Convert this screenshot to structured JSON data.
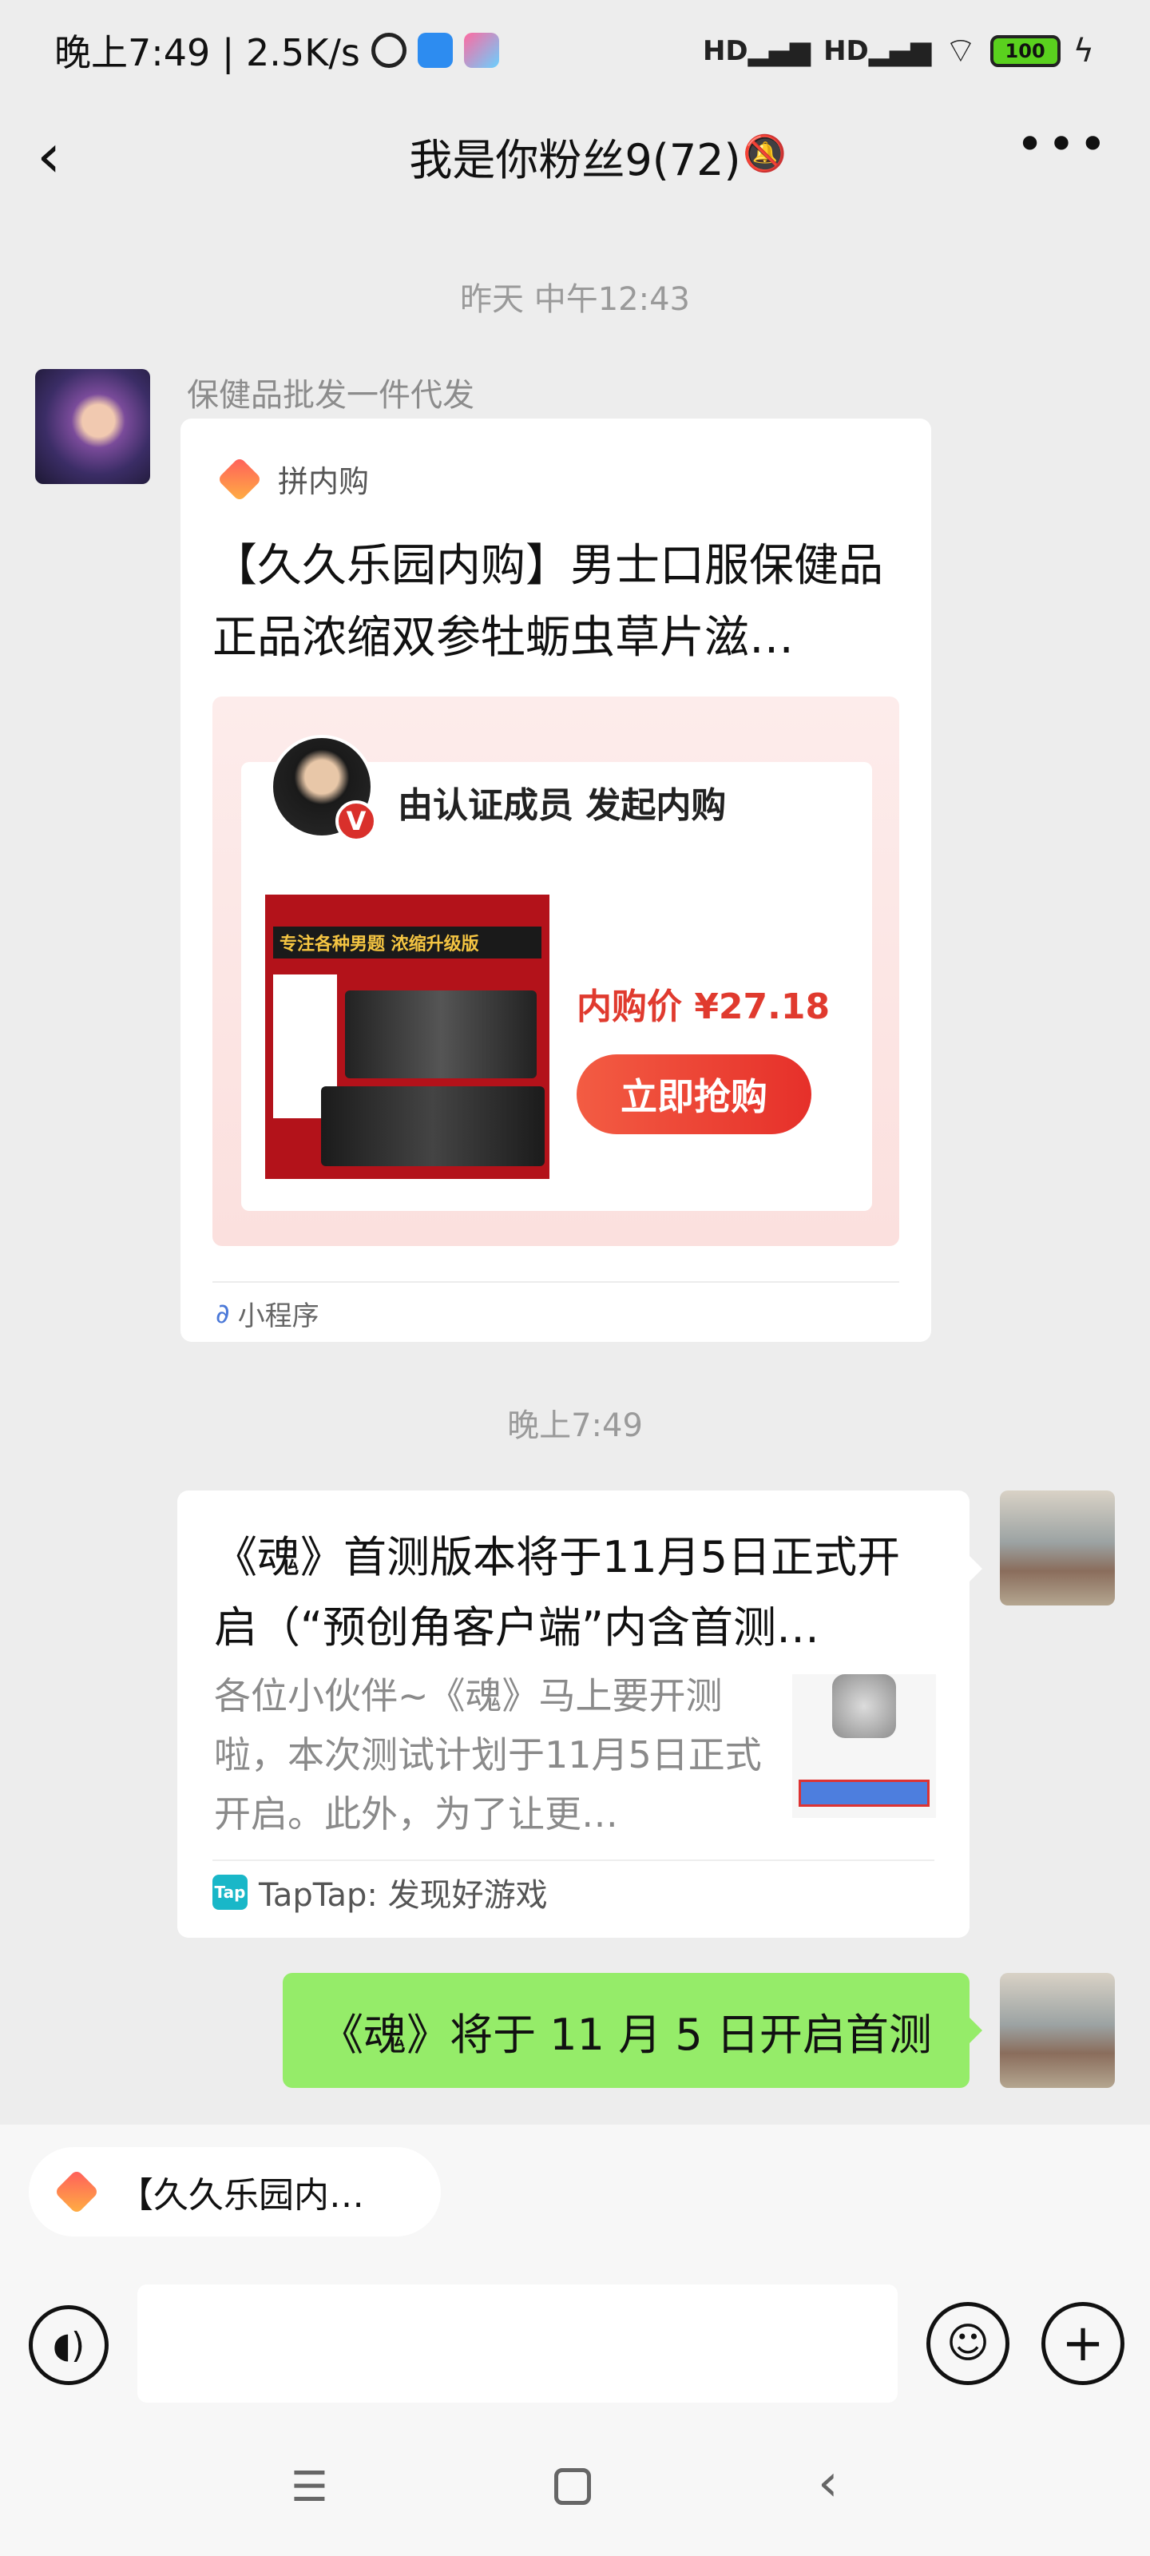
{
  "status_bar": {
    "time_speed": "晚上7:49 | 2.5K/s",
    "signal1": "HD",
    "signal2": "HD",
    "battery": "100"
  },
  "header": {
    "title": "我是你粉丝9(72)"
  },
  "messages": {
    "time1": "昨天 中午12:43",
    "sender_name": "保健品批发一件代发",
    "mini_program": {
      "app_name": "拼内购",
      "title": "【久久乐园内购】男士口服保健品正品浓缩双参牡蛎虫草片滋…",
      "organizer_label": "由认证成员 发起内购",
      "verified_badge": "V",
      "product_banner": "专注各种男题 浓缩升级版",
      "price": "内购价 ¥27.18",
      "buy_button": "立即抢购",
      "footer": "小程序"
    },
    "time2": "晚上7:49",
    "link_card": {
      "title": "《魂》首测版本将于11月5日正式开启（“预创角客户端”内含首测…",
      "description": "各位小伙伴~《魂》马上要开测啦，本次测试计划于11月5日正式开启。此外，为了让更…",
      "source_icon": "Tap",
      "source": "TapTap: 发现好游戏"
    },
    "text_message": "《魂》将于 11 月 5 日开启首测"
  },
  "input_area": {
    "quote_chip": "【久久乐园内…",
    "input_value": ""
  },
  "icons": {
    "back": "chevron-left-icon",
    "mute": "bell-off-icon",
    "more": "more-icon"
  },
  "colors": {
    "bubble_green": "#95ec69",
    "buy_red": "#e6302a",
    "taptap": "#19b7c8"
  }
}
